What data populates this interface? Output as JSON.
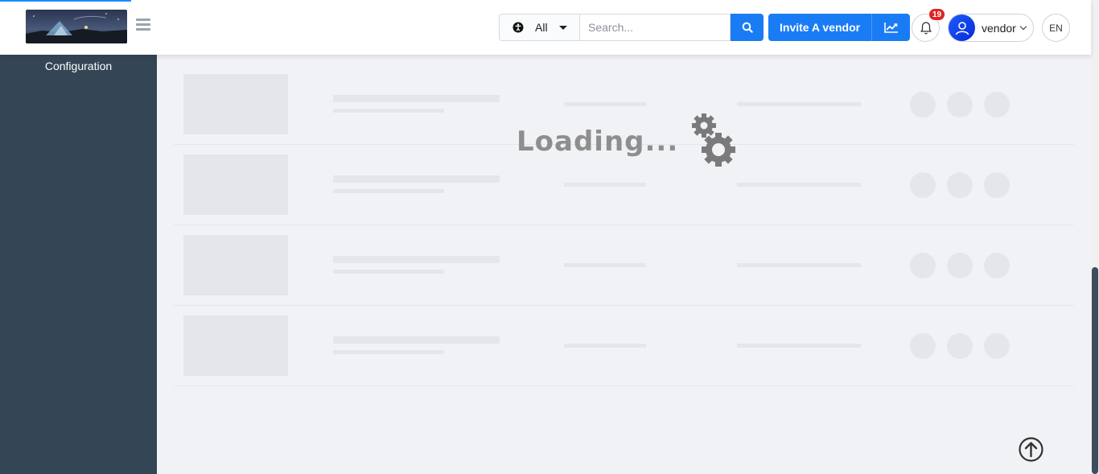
{
  "header": {
    "search_scope": "All",
    "search_placeholder": "Search...",
    "invite_label": "Invite A vendor",
    "notification_count": "19",
    "user_name": "vendor",
    "language": "EN"
  },
  "sidebar": {
    "items": [
      {
        "label": "Configuration"
      }
    ]
  },
  "main": {
    "loading_text": "Loading..."
  },
  "colors": {
    "accent": "#1a7cf5",
    "sidebar_bg": "#344555",
    "badge": "#e02424"
  }
}
